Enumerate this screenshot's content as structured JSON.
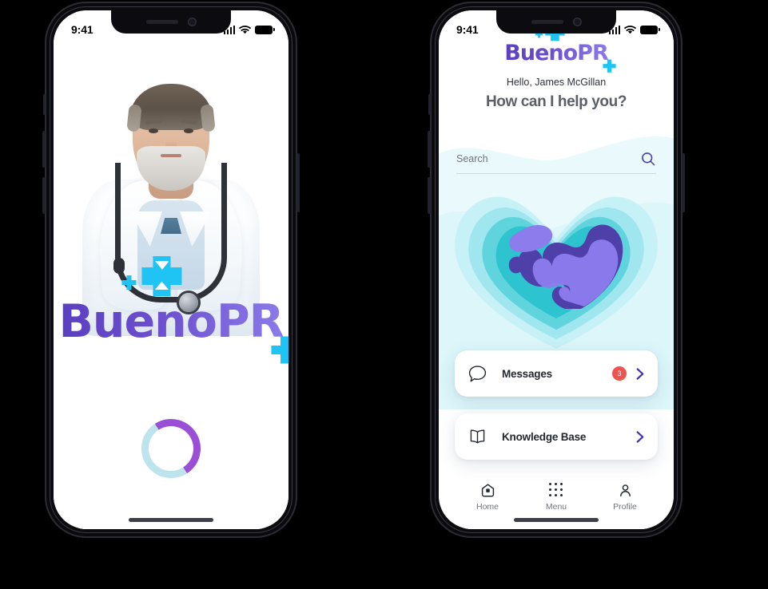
{
  "meta": {
    "background_color": "#000000",
    "brand_name": "BuenoPR",
    "accent_purple": "#6b4ecd",
    "accent_cyan": "#1fc4f4",
    "badge_red": "#ef5350"
  },
  "phones": {
    "left": {
      "screen_name": "splash-screen",
      "status_bar": {
        "time": "9:41",
        "cellular_icon": "signal-bars-icon",
        "wifi_icon": "wifi-icon",
        "battery_icon": "battery-full-icon"
      },
      "hero_image_alt": "doctor-portrait",
      "logo": {
        "text": "BuenoPR",
        "mark_icon": "hourglass-cross-icon",
        "small_cross_left_icon": "cross-icon",
        "small_cross_right_icon": "cross-icon"
      },
      "loader": {
        "icon": "loading-spinner-icon",
        "track_color": "#bde3ec",
        "arc_color": "#9b4fd6"
      },
      "home_indicator": "home-indicator"
    },
    "right": {
      "screen_name": "home-screen",
      "status_bar": {
        "time": "9:41",
        "cellular_icon": "signal-bars-icon",
        "wifi_icon": "wifi-icon",
        "battery_icon": "battery-full-icon"
      },
      "header": {
        "logo_text": "BuenoPR",
        "logo_mark_icon": "hourglass-cross-icon",
        "greeting": "Hello, James McGillan",
        "headline": "How can I help you?"
      },
      "search": {
        "placeholder": "Search",
        "value": "",
        "icon": "search-icon"
      },
      "illustration": {
        "name": "layered-heart-illustration",
        "layer_colors": [
          "#e4f8fb",
          "#bdeff6",
          "#8fe3e8",
          "#4ecfd8",
          "#2bc5cd",
          "#4f3fa8",
          "#8c7cec"
        ]
      },
      "cards": [
        {
          "label": "Messages",
          "icon": "chat-bubble-icon",
          "badge": "3",
          "chevron_icon": "chevron-right-icon"
        },
        {
          "label": "Knowledge Base",
          "icon": "open-book-icon",
          "badge": null,
          "chevron_icon": "chevron-right-icon"
        }
      ],
      "tabbar": [
        {
          "label": "Home",
          "icon": "home-icon",
          "active": true
        },
        {
          "label": "Menu",
          "icon": "grid-dots-icon",
          "active": false
        },
        {
          "label": "Profile",
          "icon": "person-icon",
          "active": false
        }
      ],
      "home_indicator": "home-indicator"
    }
  }
}
